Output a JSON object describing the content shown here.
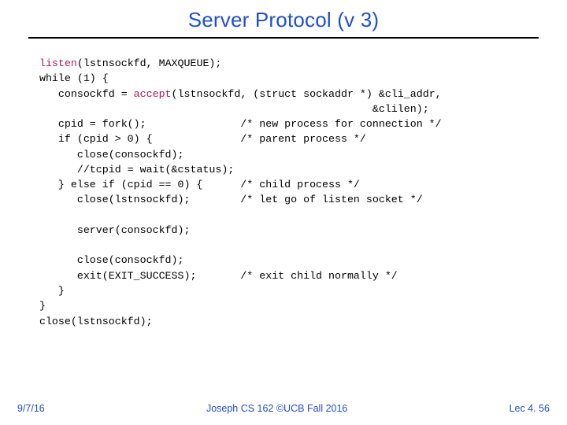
{
  "title": "Server Protocol (v 3)",
  "code": {
    "l1a": "  ",
    "l1b": "listen",
    "l1c": "(lstnsockfd, MAXQUEUE);",
    "l2": "  while (1) {",
    "l3a": "     consockfd = ",
    "l3b": "accept",
    "l3c": "(lstnsockfd, (struct sockaddr *) &cli_addr,",
    "l4": "                                                       &clilen);",
    "l5": "     cpid = fork();               /* new process for connection */",
    "l6": "     if (cpid > 0) {              /* parent process */",
    "l7": "        close(consockfd);",
    "l8": "        //tcpid = wait(&cstatus);",
    "l9": "     } else if (cpid == 0) {      /* child process */",
    "l10": "        close(lstnsockfd);        /* let go of listen socket */",
    "blank1": "",
    "l11": "        server(consockfd);",
    "blank2": "",
    "l12": "        close(consockfd);",
    "l13": "        exit(EXIT_SUCCESS);       /* exit child normally */",
    "l14": "     }",
    "l15": "  }",
    "l16": "  close(lstnsockfd);"
  },
  "footer": {
    "date": "9/7/16",
    "center": "Joseph CS 162 ©UCB Fall 2016",
    "lec": "Lec 4. 56"
  }
}
